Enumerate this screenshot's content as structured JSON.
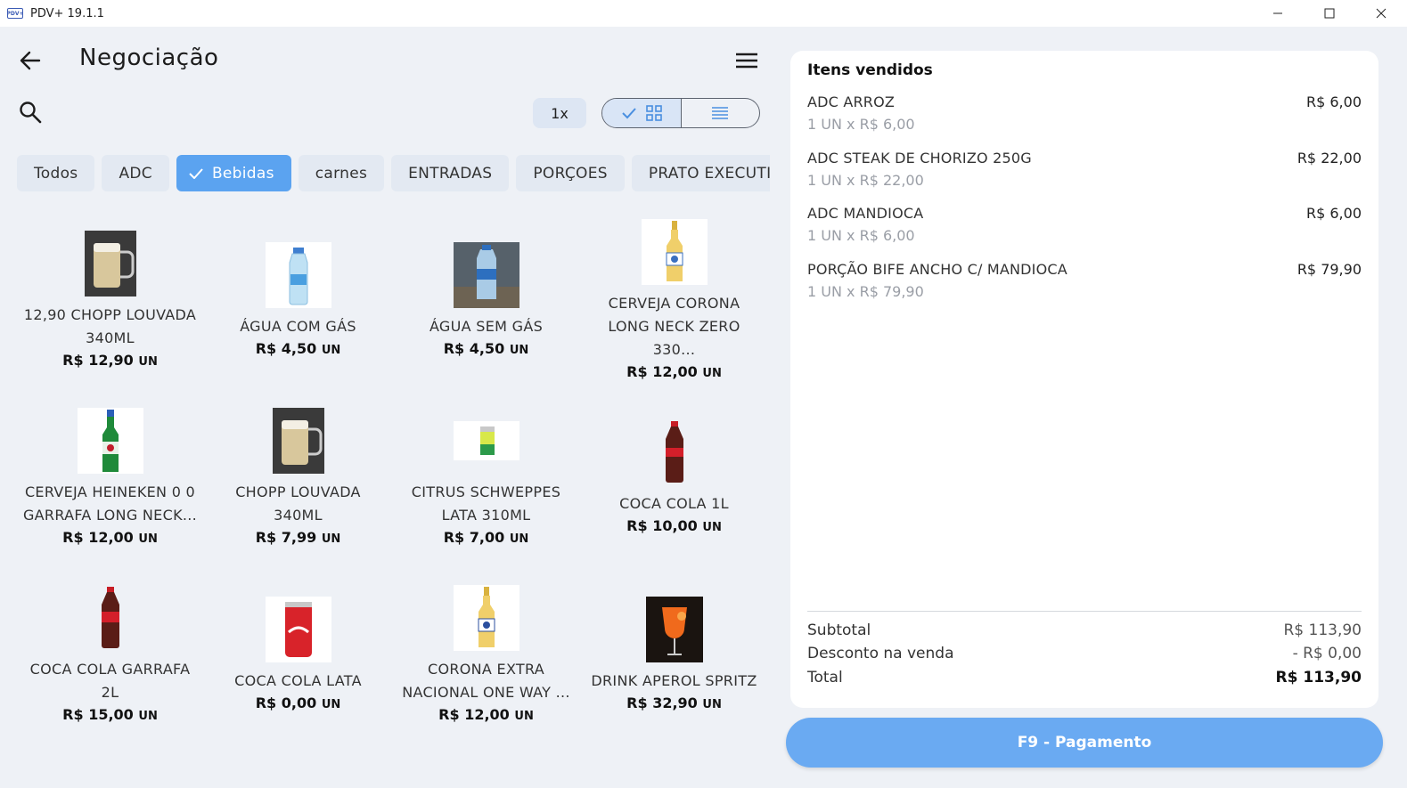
{
  "window": {
    "logo_text": "PDV+",
    "title": "PDV+ 19.1.1",
    "minimize": "—",
    "maximize": "☐",
    "close": "✕"
  },
  "header": {
    "title": "Negociação",
    "quantity": "1x"
  },
  "categories": [
    {
      "label": "Todos",
      "selected": false
    },
    {
      "label": "ADC",
      "selected": false
    },
    {
      "label": "Bebidas",
      "selected": true
    },
    {
      "label": "carnes",
      "selected": false
    },
    {
      "label": "ENTRADAS",
      "selected": false
    },
    {
      "label": "PORÇOES",
      "selected": false
    },
    {
      "label": "PRATO EXECUTIVO",
      "selected": false
    }
  ],
  "products": [
    {
      "name": "12,90 CHOPP LOUVADA 340ML",
      "price": "R$ 12,90",
      "unit": "UN"
    },
    {
      "name": "ÁGUA COM GÁS",
      "price": "R$ 4,50",
      "unit": "UN"
    },
    {
      "name": "ÁGUA SEM GÁS",
      "price": "R$ 4,50",
      "unit": "UN"
    },
    {
      "name": "CERVEJA CORONA LONG NECK ZERO 330...",
      "price": "R$ 12,00",
      "unit": "UN"
    },
    {
      "name": "CERVEJA HEINEKEN 0 0 GARRAFA LONG NECK...",
      "price": "R$ 12,00",
      "unit": "UN"
    },
    {
      "name": "CHOPP LOUVADA 340ML",
      "price": "R$ 7,99",
      "unit": "UN"
    },
    {
      "name": "CITRUS SCHWEPPES LATA 310ML",
      "price": "R$ 7,00",
      "unit": "UN"
    },
    {
      "name": "COCA COLA 1L",
      "price": "R$ 10,00",
      "unit": "UN"
    },
    {
      "name": "COCA COLA GARRAFA 2L",
      "price": "R$ 15,00",
      "unit": "UN"
    },
    {
      "name": "COCA COLA LATA",
      "price": "R$ 0,00",
      "unit": "UN"
    },
    {
      "name": "CORONA EXTRA NACIONAL ONE WAY ...",
      "price": "R$ 12,00",
      "unit": "UN"
    },
    {
      "name": "DRINK APEROL SPRITZ",
      "price": "R$ 32,90",
      "unit": "UN"
    }
  ],
  "cart": {
    "title": "Itens vendidos",
    "items": [
      {
        "name": "ADC ARROZ",
        "price": "R$ 6,00",
        "detail": "1 UN x R$ 6,00"
      },
      {
        "name": "ADC STEAK DE CHORIZO 250G",
        "price": "R$ 22,00",
        "detail": "1 UN x R$ 22,00"
      },
      {
        "name": "ADC MANDIOCA",
        "price": "R$ 6,00",
        "detail": "1 UN x R$ 6,00"
      },
      {
        "name": "PORÇÃO BIFE ANCHO C/ MANDIOCA",
        "price": "R$ 79,90",
        "detail": "1 UN x R$ 79,90"
      }
    ],
    "subtotal_label": "Subtotal",
    "subtotal_value": "R$ 113,90",
    "discount_label": "Desconto na venda",
    "discount_value": "- R$ 0,00",
    "total_label": "Total",
    "total_value": "R$ 113,90"
  },
  "payment_button": "F9 - Pagamento",
  "colors": {
    "accent": "#5ba3f0",
    "pay_button": "#6aaaf2",
    "background": "#eef1f6"
  }
}
